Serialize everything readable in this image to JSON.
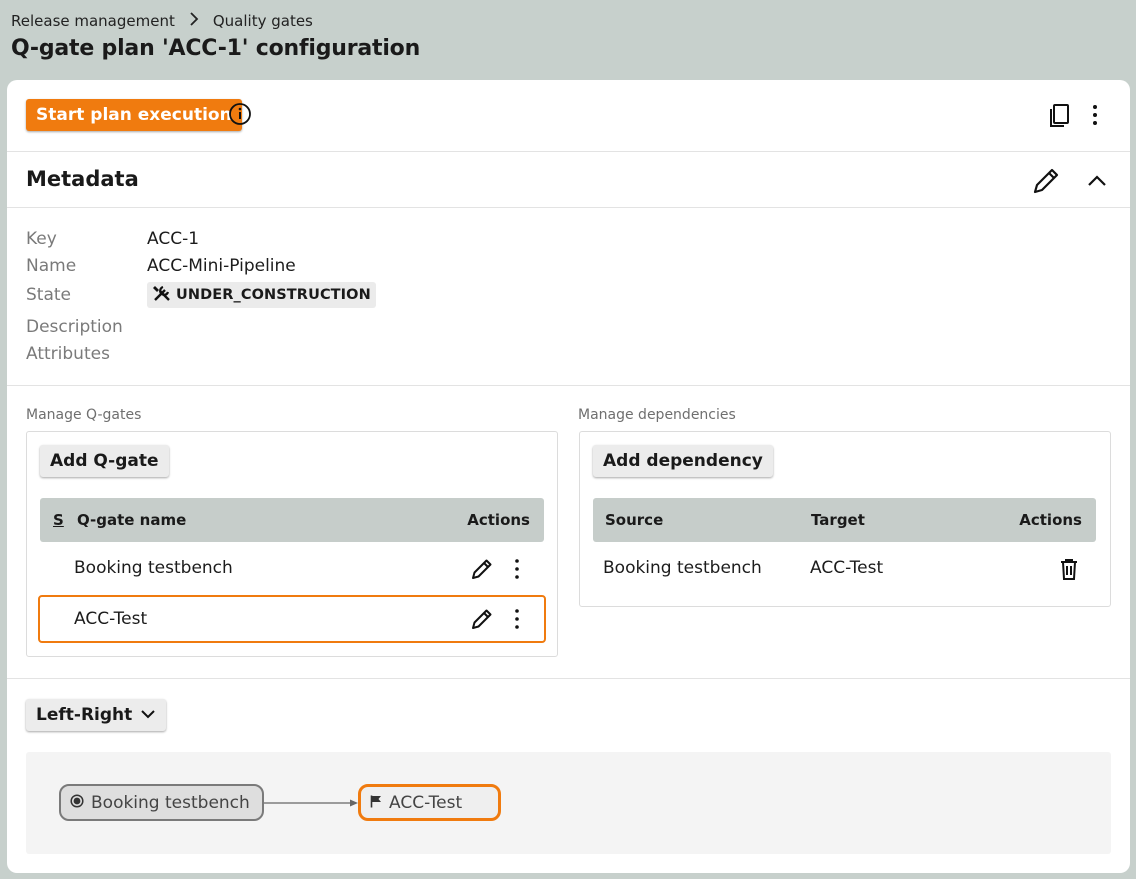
{
  "breadcrumb": {
    "items": [
      "Release management",
      "Quality gates"
    ],
    "separator": "›"
  },
  "page": {
    "title": "Q-gate plan 'ACC-1' configuration"
  },
  "toolbar": {
    "start_label": "Start plan execution"
  },
  "metadata": {
    "title": "Metadata",
    "key_label": "Key",
    "key_value": "ACC-1",
    "name_label": "Name",
    "name_value": "ACC-Mini-Pipeline",
    "state_label": "State",
    "state_value": "UNDER_CONSTRUCTION",
    "description_label": "Description",
    "attributes_label": "Attributes"
  },
  "qgates": {
    "section_label": "Manage Q-gates",
    "add_label": "Add Q-gate",
    "col_status": "S",
    "col_name": "Q-gate name",
    "col_actions": "Actions",
    "rows": [
      {
        "name": "Booking testbench",
        "selected": false
      },
      {
        "name": "ACC-Test",
        "selected": true
      }
    ]
  },
  "dependencies": {
    "section_label": "Manage dependencies",
    "add_label": "Add dependency",
    "col_source": "Source",
    "col_target": "Target",
    "col_actions": "Actions",
    "rows": [
      {
        "source": "Booking testbench",
        "target": "ACC-Test"
      }
    ]
  },
  "layout": {
    "direction_label": "Left-Right"
  },
  "graph": {
    "nodes": [
      {
        "label": "Booking testbench",
        "icon": "radio-dot-icon"
      },
      {
        "label": "ACC-Test",
        "icon": "flag-icon"
      }
    ]
  },
  "colors": {
    "accent": "#f07b0f",
    "header_bg": "#c7d0cc",
    "table_header": "#c6cdca"
  }
}
